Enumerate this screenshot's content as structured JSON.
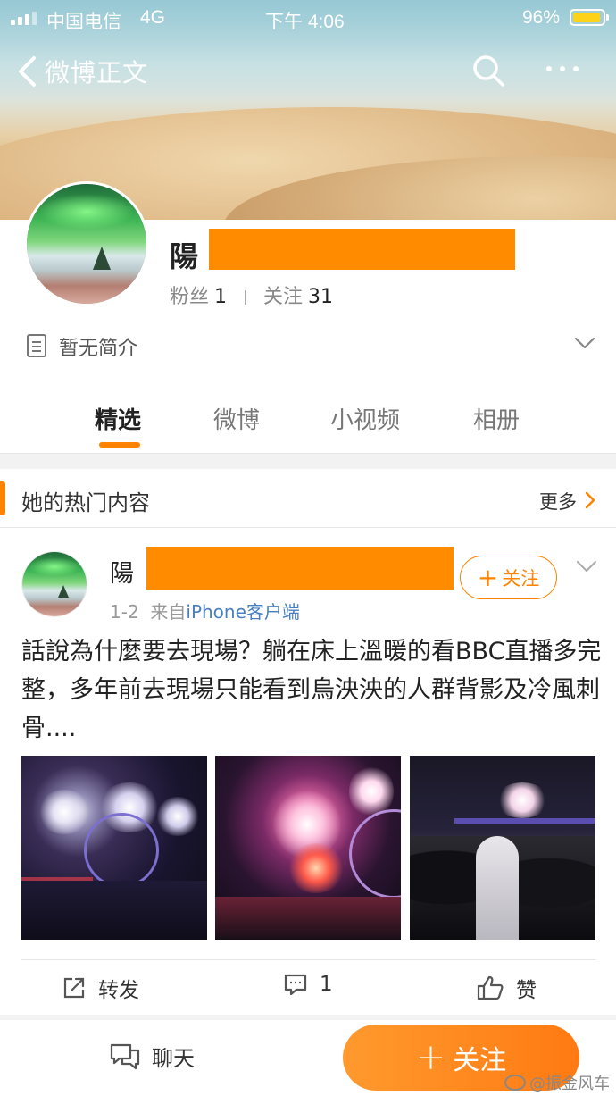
{
  "status_bar": {
    "carrier": "中国电信",
    "network": "4G",
    "time": "下午 4:06",
    "battery": "96%"
  },
  "nav": {
    "title": "微博正文",
    "back_icon": "chevron-left-icon",
    "search_icon": "search-icon",
    "more_icon": "more-horizontal-icon"
  },
  "profile": {
    "name": "陽",
    "fans_label": "粉丝",
    "fans_count": "1",
    "following_label": "关注",
    "following_count": "31",
    "bio": "暂无简介"
  },
  "tabs": [
    {
      "label": "精选",
      "active": true
    },
    {
      "label": "微博",
      "active": false
    },
    {
      "label": "小视频",
      "active": false
    },
    {
      "label": "相册",
      "active": false
    }
  ],
  "hot_section": {
    "title": "她的热门内容",
    "more": "更多"
  },
  "post": {
    "author": "陽",
    "follow_label": "关注",
    "date": "1-2",
    "source_prefix": "来自",
    "source": "iPhone客户端",
    "text": "話說為什麼要去現場？躺在床上溫暖的看BBC直播多完整，多年前去現場只能看到烏泱泱的人群背影及冷風刺骨....",
    "photos": [
      "fireworks-photo-1",
      "fireworks-photo-2",
      "crowd-photo-3"
    ],
    "actions": {
      "repost": "转发",
      "comment_count": "1",
      "like": "赞"
    }
  },
  "bottom_bar": {
    "chat": "聊天",
    "follow": "关注",
    "watermark": "@振金风车"
  },
  "colors": {
    "accent": "#ff8200",
    "redaction": "#ff8c00",
    "link": "#4a7fbf"
  }
}
